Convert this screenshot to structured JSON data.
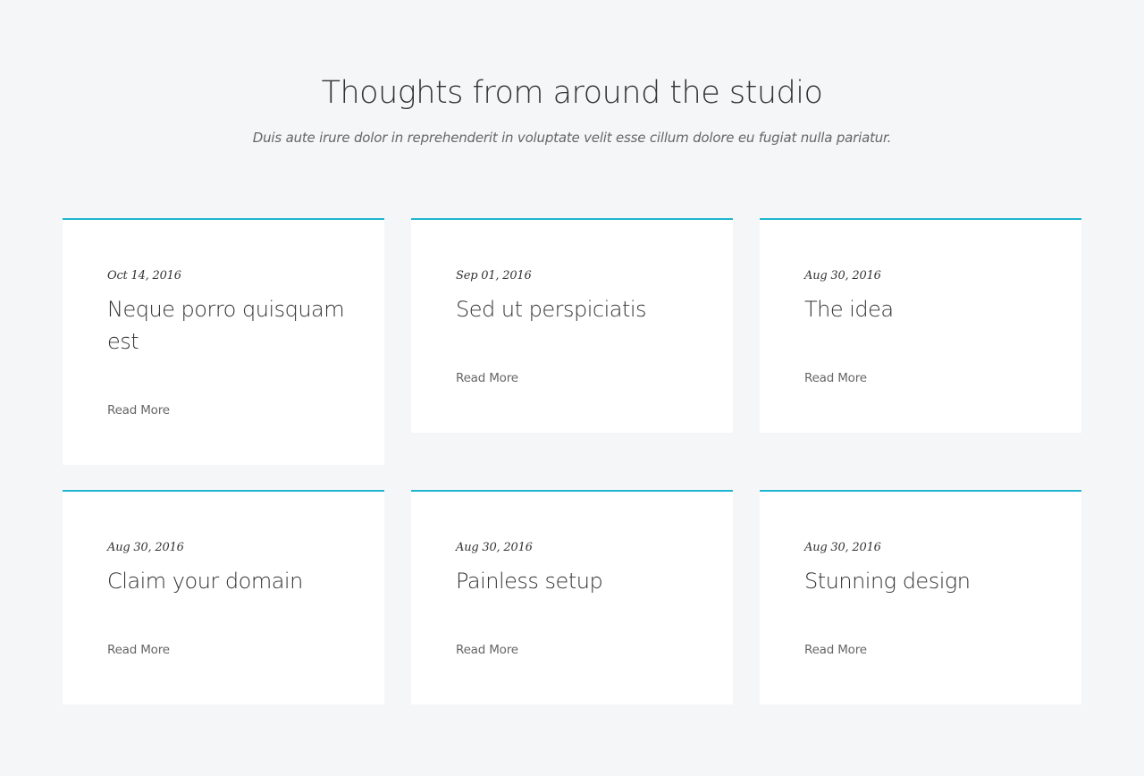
{
  "section": {
    "title": "Thoughts from around the studio",
    "subtitle": "Duis aute irure dolor in reprehenderit in voluptate velit esse cillum dolore eu fugiat nulla pariatur."
  },
  "accent_color": "#1fb5cf",
  "posts": [
    {
      "date": "Oct 14, 2016",
      "title": "Neque porro quisquam est",
      "link_label": "Read More"
    },
    {
      "date": "Sep 01, 2016",
      "title": "Sed ut perspiciatis",
      "link_label": "Read More"
    },
    {
      "date": "Aug 30, 2016",
      "title": "The idea",
      "link_label": "Read More"
    },
    {
      "date": "Aug 30, 2016",
      "title": "Claim your domain",
      "link_label": "Read More"
    },
    {
      "date": "Aug 30, 2016",
      "title": "Painless setup",
      "link_label": "Read More"
    },
    {
      "date": "Aug 30, 2016",
      "title": "Stunning design",
      "link_label": "Read More"
    }
  ]
}
